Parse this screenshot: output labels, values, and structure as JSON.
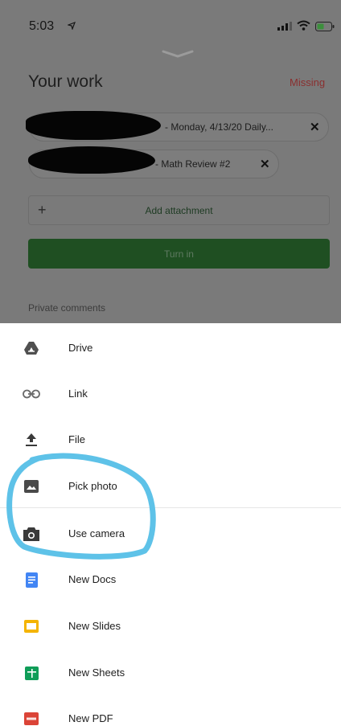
{
  "status_bar": {
    "time": "5:03"
  },
  "your_work": {
    "title": "Your work",
    "status": "Missing",
    "attachments": [
      {
        "label": "- Monday, 4/13/20 Daily...",
        "close": "✕"
      },
      {
        "label": "- Math Review #2",
        "close": "✕"
      }
    ],
    "add_attachment": {
      "icon": "+",
      "label": "Add attachment"
    },
    "turn_in_label": "Turn in",
    "private_comments_label": "Private comments"
  },
  "sheet": {
    "items": [
      {
        "label": "Drive",
        "icon": "drive-icon"
      },
      {
        "label": "Link",
        "icon": "link-icon"
      },
      {
        "label": "File",
        "icon": "upload-icon"
      },
      {
        "label": "Pick photo",
        "icon": "photo-icon"
      },
      {
        "label": "Use camera",
        "icon": "camera-icon"
      },
      {
        "label": "New Docs",
        "icon": "docs-icon"
      },
      {
        "label": "New Slides",
        "icon": "slides-icon"
      },
      {
        "label": "New Sheets",
        "icon": "sheets-icon"
      },
      {
        "label": "New PDF",
        "icon": "pdf-icon"
      }
    ]
  },
  "colors": {
    "highlight_circle": "#5ec2e8",
    "docs_blue": "#4285f4",
    "slides_yellow": "#f4b400",
    "sheets_green": "#0f9d58",
    "pdf_red": "#db4437",
    "missing_red": "#8a2f2f",
    "turn_in_green": "#1f4f22"
  }
}
